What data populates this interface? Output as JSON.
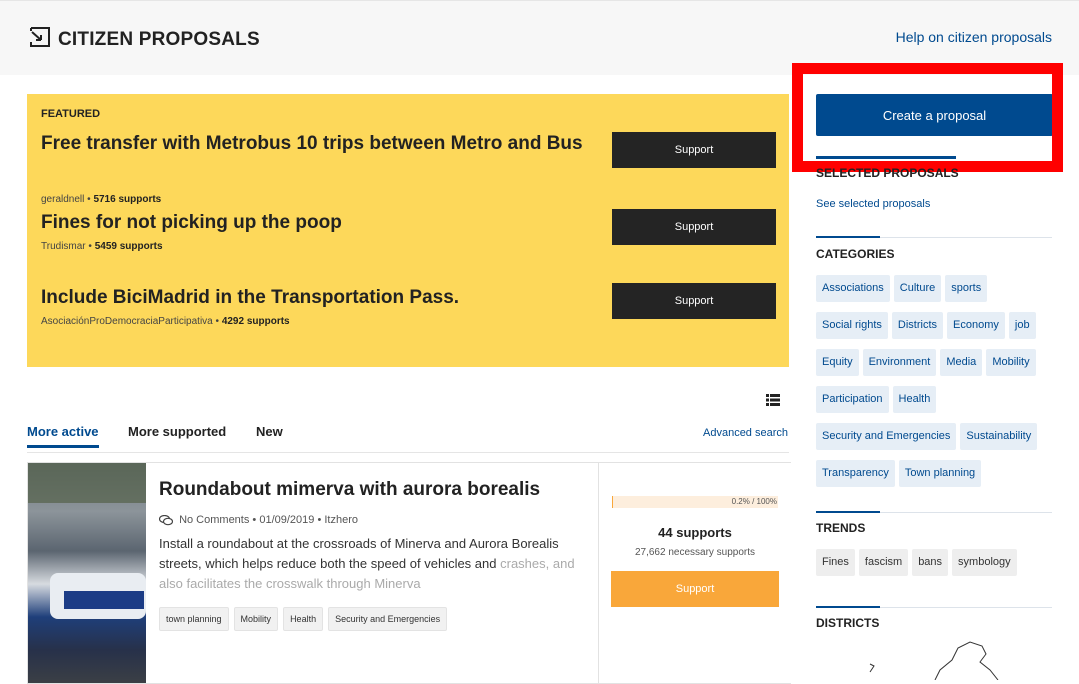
{
  "header": {
    "title": "CITIZEN PROPOSALS",
    "help_link": "Help on citizen proposals"
  },
  "featured": {
    "label": "FEATURED",
    "items": [
      {
        "title": "Free transfer with Metrobus 10 trips between Metro and Bus",
        "author": "geraldnell",
        "supports": "5716 supports",
        "button": "Support"
      },
      {
        "title": "Fines for not picking up the poop",
        "author": "Trudismar",
        "supports": "5459 supports",
        "button": "Support"
      },
      {
        "title": "Include BiciMadrid in the Transportation Pass.",
        "author": "AsociaciónProDemocraciaParticipativa",
        "supports": "4292 supports",
        "button": "Support"
      }
    ]
  },
  "tabs": [
    {
      "label": "More active",
      "active": true
    },
    {
      "label": "More supported",
      "active": false
    },
    {
      "label": "New",
      "active": false
    }
  ],
  "advanced_search": "Advanced search",
  "proposal": {
    "title": "Roundabout mimerva with aurora borealis",
    "comments": "No Comments",
    "date": "01/09/2019",
    "author": "Itzhero",
    "description": "Install a roundabout at the crossroads of Minerva and Aurora Borealis streets, which helps reduce both the speed of vehicles and",
    "description_faded": "crashes, and also facilitates the crosswalk through Minerva",
    "tags": [
      "town planning",
      "Mobility",
      "Health",
      "Security and Emergencies"
    ],
    "progress_text": "0.2% / 100%",
    "progress_percent": 0.2,
    "supports": "44 supports",
    "needed": "27,662 necessary supports",
    "button": "Support"
  },
  "sidebar": {
    "create_button": "Create a proposal",
    "selected_heading": "SELECTED PROPOSALS",
    "see_selected": "See selected proposals",
    "categories_heading": "CATEGORIES",
    "categories": [
      "Associations",
      "Culture",
      "sports",
      "Social rights",
      "Districts",
      "Economy",
      "job",
      "Equity",
      "Environment",
      "Media",
      "Mobility",
      "Participation",
      "Health",
      "Security and Emergencies",
      "Sustainability",
      "Transparency",
      "Town planning"
    ],
    "trends_heading": "TRENDS",
    "trends": [
      "Fines",
      "fascism",
      "bans",
      "symbology"
    ],
    "districts_heading": "DISTRICTS"
  },
  "colors": {
    "accent": "#004a8f",
    "featured_bg": "#fdd85a",
    "support_orange": "#f9a73a",
    "highlight": "#ff0000"
  }
}
